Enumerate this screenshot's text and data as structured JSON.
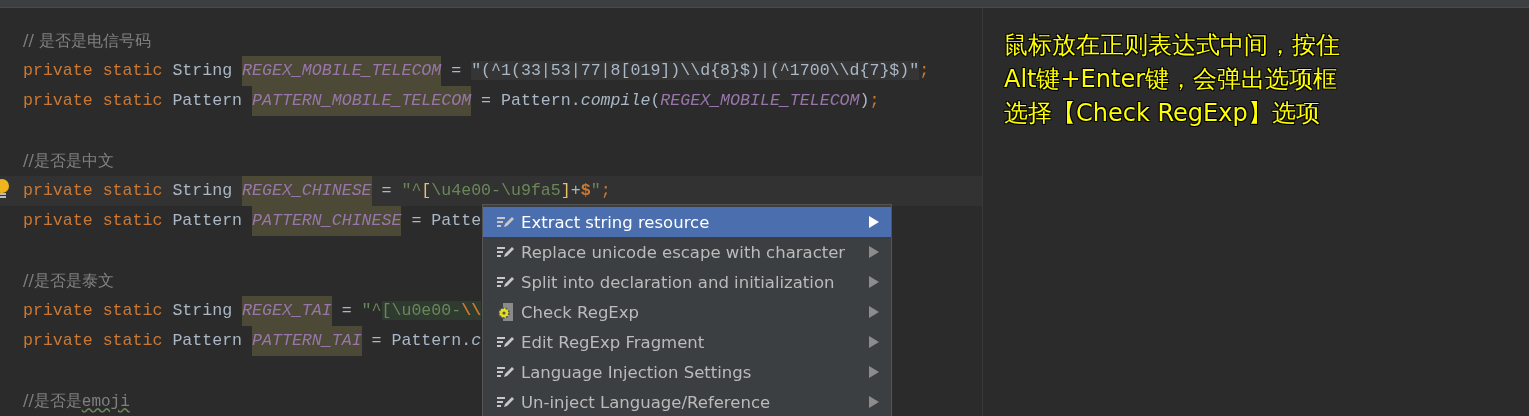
{
  "code_lines": [
    {
      "current": false,
      "tokens": [
        {
          "kind": "comment",
          "text": "// 是否是电信号码"
        }
      ]
    },
    {
      "current": false,
      "tokens": [
        {
          "kind": "keyword",
          "text": "private static "
        },
        {
          "kind": "type",
          "text": "String "
        },
        {
          "kind": "field",
          "text": "REGEX_MOBILE_TELECOM"
        },
        {
          "kind": "plain",
          "text": " = "
        },
        {
          "kind": "regex",
          "text": "\"(^1(33|53|77|8[019])\\\\d{8}$)|(^1700\\\\d{7}$)\""
        },
        {
          "kind": "punct",
          "text": ";"
        }
      ]
    },
    {
      "current": false,
      "tokens": [
        {
          "kind": "keyword",
          "text": "private static "
        },
        {
          "kind": "type",
          "text": "Pattern "
        },
        {
          "kind": "field",
          "text": "PATTERN_MOBILE_TELECOM"
        },
        {
          "kind": "plain",
          "text": " = Pattern."
        },
        {
          "kind": "method",
          "text": "compile"
        },
        {
          "kind": "plain",
          "text": "("
        },
        {
          "kind": "constant",
          "text": "REGEX_MOBILE_TELECOM"
        },
        {
          "kind": "plain",
          "text": ")"
        },
        {
          "kind": "punct",
          "text": ";"
        }
      ]
    },
    {
      "current": false
    },
    {
      "current": false,
      "tokens": [
        {
          "kind": "comment",
          "text": "//是否是中文"
        }
      ]
    },
    {
      "current": true,
      "tokens": [
        {
          "kind": "keyword",
          "text": "private static "
        },
        {
          "kind": "type",
          "text": "String "
        },
        {
          "kind": "field",
          "text": "REGEX_CHINESE"
        },
        {
          "kind": "plain",
          "text": " = "
        },
        {
          "kind": "string",
          "text": "\"^"
        },
        {
          "kind": "bracket",
          "text": "["
        },
        {
          "kind": "string",
          "text": "\\u4e00-\\u9fa5"
        },
        {
          "kind": "bracket",
          "text": "]"
        },
        {
          "kind": "plain",
          "text": "+"
        },
        {
          "kind": "anchor",
          "text": "$"
        },
        {
          "kind": "string",
          "text": "\""
        },
        {
          "kind": "punct",
          "text": ";"
        }
      ]
    },
    {
      "current": false,
      "tokens": [
        {
          "kind": "keyword",
          "text": "private static "
        },
        {
          "kind": "type",
          "text": "Pattern "
        },
        {
          "kind": "field",
          "text": "PATTERN_CHINESE"
        },
        {
          "kind": "plain",
          "text": " = Patte"
        }
      ]
    },
    {
      "current": false
    },
    {
      "current": false,
      "tokens": [
        {
          "kind": "comment",
          "text": "//是否是泰文"
        }
      ]
    },
    {
      "current": false,
      "tokens": [
        {
          "kind": "keyword",
          "text": "private static "
        },
        {
          "kind": "type",
          "text": "String "
        },
        {
          "kind": "field",
          "text": "REGEX_TAI"
        },
        {
          "kind": "plain",
          "text": " = "
        },
        {
          "kind": "string",
          "text": "\"^"
        },
        {
          "kind": "injected",
          "text": "[\\u0e00-"
        },
        {
          "kind": "escape",
          "text": "\\\\"
        }
      ]
    },
    {
      "current": false,
      "tokens": [
        {
          "kind": "keyword",
          "text": "private static "
        },
        {
          "kind": "type",
          "text": "Pattern "
        },
        {
          "kind": "field",
          "text": "PATTERN_TAI"
        },
        {
          "kind": "plain",
          "text": " = Pattern."
        },
        {
          "kind": "method",
          "text": "c"
        }
      ]
    },
    {
      "current": false
    },
    {
      "current": false,
      "tokens": [
        {
          "kind": "comment",
          "text": "//是否是"
        },
        {
          "kind": "typo",
          "text": "emoji"
        }
      ]
    }
  ],
  "intention_menu": {
    "items": [
      {
        "label": "Extract string resource",
        "kind": "intention",
        "selected": true
      },
      {
        "label": "Replace unicode escape with character",
        "kind": "intention",
        "selected": false
      },
      {
        "label": "Split into declaration and initialization",
        "kind": "intention",
        "selected": false
      },
      {
        "label": "Check RegExp",
        "kind": "regexp",
        "selected": false
      },
      {
        "label": "Edit RegExp Fragment",
        "kind": "intention",
        "selected": false
      },
      {
        "label": "Language Injection Settings",
        "kind": "intention",
        "selected": false
      },
      {
        "label": "Un-inject Language/Reference",
        "kind": "intention",
        "selected": false
      }
    ]
  },
  "annotation": {
    "lines": [
      "鼠标放在正则表达式中间，按住",
      "Alt键+Enter键，会弹出选项框",
      "选择【Check RegExp】选项"
    ]
  }
}
